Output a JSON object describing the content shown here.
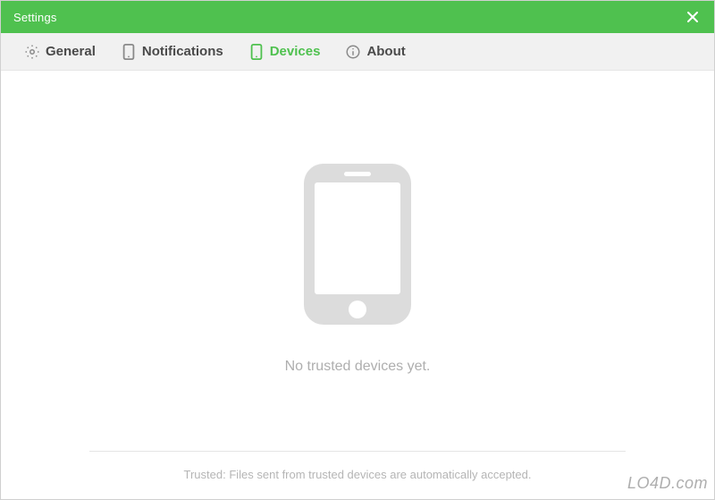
{
  "titlebar": {
    "title": "Settings"
  },
  "tabs": {
    "general": {
      "label": "General",
      "icon": "gear-icon"
    },
    "notifications": {
      "label": "Notifications",
      "icon": "phone-small-icon"
    },
    "devices": {
      "label": "Devices",
      "icon": "phone-small-icon",
      "active": true
    },
    "about": {
      "label": "About",
      "icon": "info-icon"
    }
  },
  "main": {
    "empty_text": "No trusted devices yet.",
    "footer_text": "Trusted: Files sent from trusted devices are automatically accepted."
  },
  "watermark": "LO4D.com",
  "colors": {
    "accent": "#4fc14f",
    "tab_inactive": "#4a4a4a",
    "muted": "#aeaeae"
  }
}
